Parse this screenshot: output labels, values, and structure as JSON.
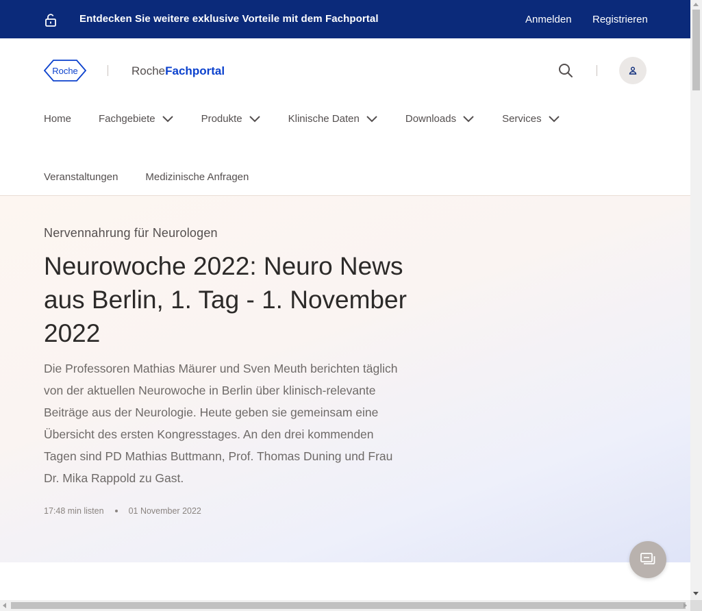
{
  "topbar": {
    "promo": "Entdecken Sie weitere exklusive Vorteile mit dem Fachportal",
    "login": "Anmelden",
    "register": "Registrieren",
    "icon": "lock-open-icon",
    "background": "#0b2a7a"
  },
  "header": {
    "logo_text": "Roche",
    "portal_prefix": "Roche",
    "portal_suffix": "Fachportal",
    "brand_color": "#0b41cd"
  },
  "nav": {
    "items": [
      {
        "label": "Home"
      },
      {
        "label": "Fachgebiete"
      },
      {
        "label": "Produkte"
      },
      {
        "label": "Klinische Daten"
      },
      {
        "label": "Downloads"
      },
      {
        "label": "Services"
      },
      {
        "label": "Veranstaltungen"
      },
      {
        "label": "Medizinische Anfragen"
      }
    ]
  },
  "hero": {
    "kicker": "Nervennahrung für Neurologen",
    "headline": "Neurowoche 2022: Neuro News aus Berlin, 1. Tag - 1. November 2022",
    "lead": "Die Professoren Mathias Mäurer und Sven Meuth berichten täglich von der aktuellen Neurowoche in Berlin über klinisch-relevante Beiträge aus der Neurologie. Heute geben sie gemeinsam eine Übersicht des ersten Kongresstages. An den drei kommenden Tagen sind PD Mathias Buttmann, Prof. Thomas Duning und Frau Dr. Mika Rappold zu Gast.",
    "duration": "17:48 min listen",
    "date": "01 November 2022"
  }
}
